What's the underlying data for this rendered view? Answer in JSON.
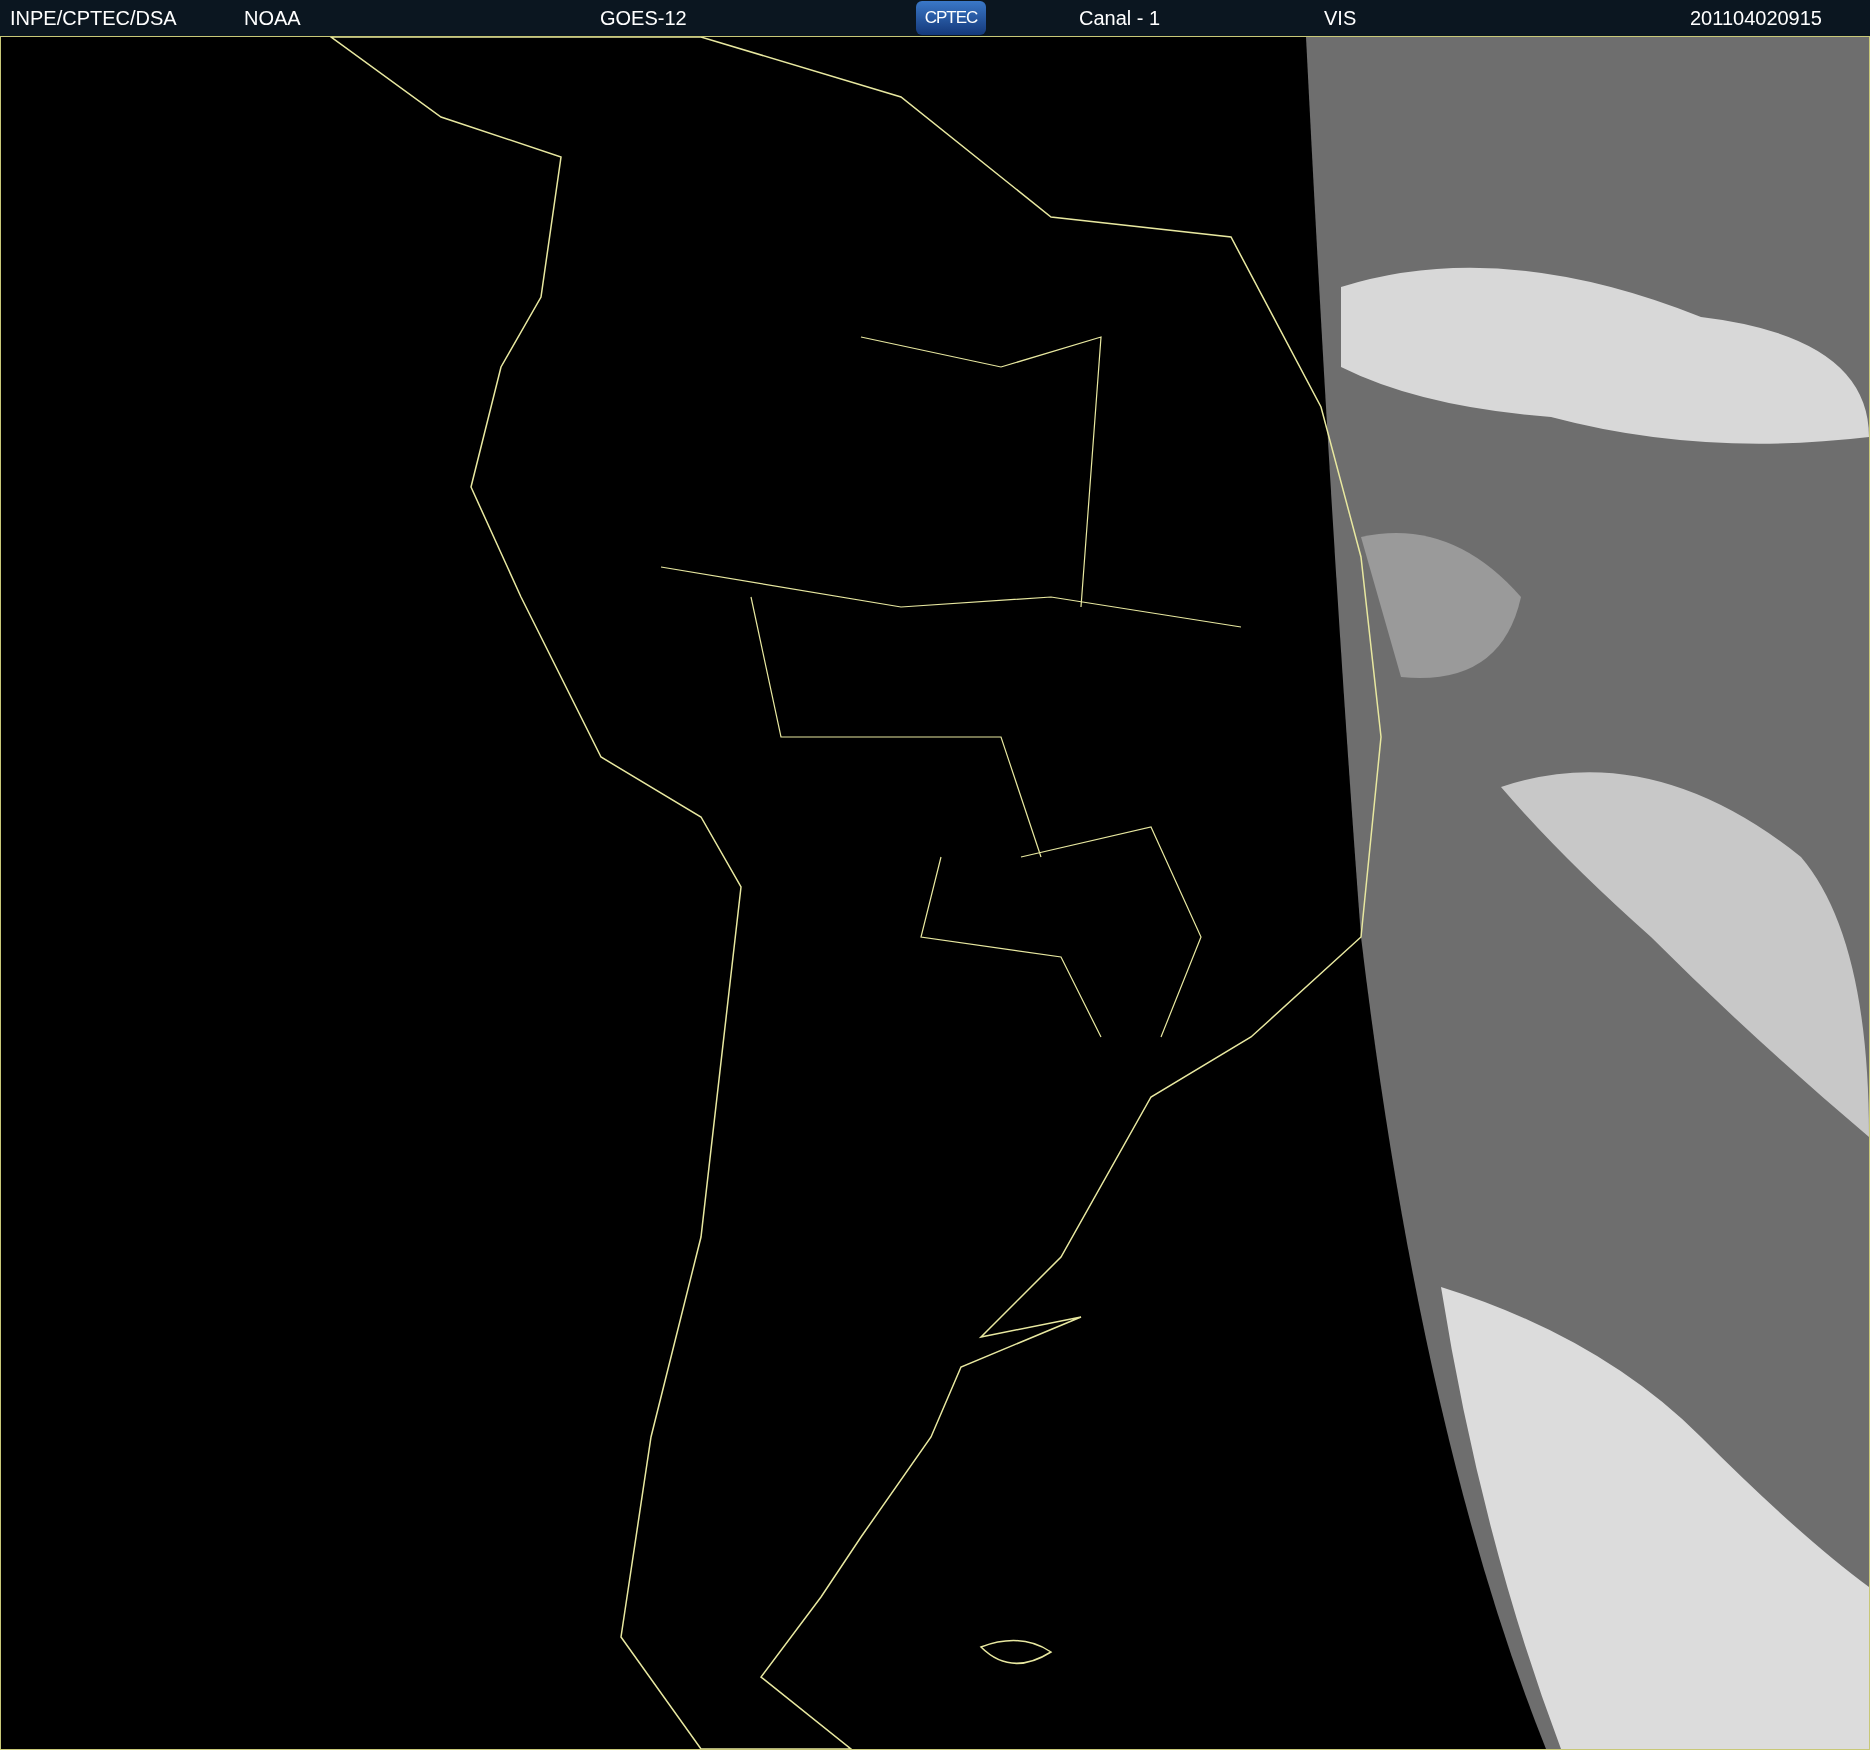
{
  "header": {
    "source": "INPE/CPTEC/DSA",
    "agency": "NOAA",
    "satellite": "GOES-12",
    "logo": "CPTEC",
    "channel": "Canal - 1",
    "band": "VIS",
    "timestamp": "201104020915"
  }
}
